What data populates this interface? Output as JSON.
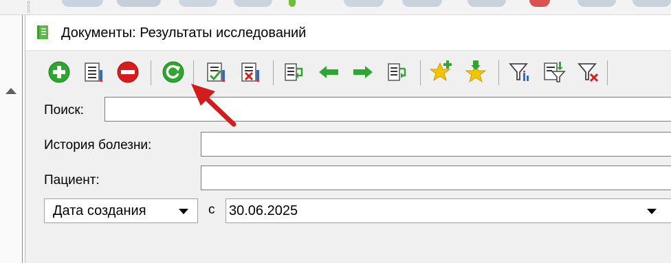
{
  "window": {
    "title": "Документы: Результаты исследований"
  },
  "toolbar": {
    "buttons": [
      {
        "name": "add-icon",
        "tooltip": ""
      },
      {
        "name": "edit-document-icon",
        "tooltip": ""
      },
      {
        "name": "delete-icon",
        "tooltip": ""
      },
      {
        "name": "refresh-icon",
        "tooltip": ""
      },
      {
        "name": "check-document-icon",
        "tooltip": ""
      },
      {
        "name": "cancel-document-icon",
        "tooltip": ""
      },
      {
        "name": "move-document-icon",
        "tooltip": ""
      },
      {
        "name": "arrow-left-icon",
        "tooltip": ""
      },
      {
        "name": "arrow-right-icon",
        "tooltip": ""
      },
      {
        "name": "move-document-back-icon",
        "tooltip": ""
      },
      {
        "name": "favorite-add-icon",
        "tooltip": ""
      },
      {
        "name": "favorite-down-icon",
        "tooltip": ""
      },
      {
        "name": "filter-settings-icon",
        "tooltip": ""
      },
      {
        "name": "filter-document-icon",
        "tooltip": ""
      },
      {
        "name": "filter-clear-icon",
        "tooltip": ""
      }
    ]
  },
  "filters": {
    "search_label": "Поиск:",
    "search_value": "",
    "history_label": "История болезни:",
    "history_value": "",
    "patient_label": "Пациент:",
    "patient_value": "",
    "date_type_value": "Дата создания",
    "date_from_label": "с",
    "date_from_value": "30.06.2025"
  },
  "colors": {
    "accent_green": "#2fa62f",
    "delete_red": "#d81b1b",
    "star_yellow": "#f5c400",
    "annotation_arrow": "#d31d1d"
  }
}
